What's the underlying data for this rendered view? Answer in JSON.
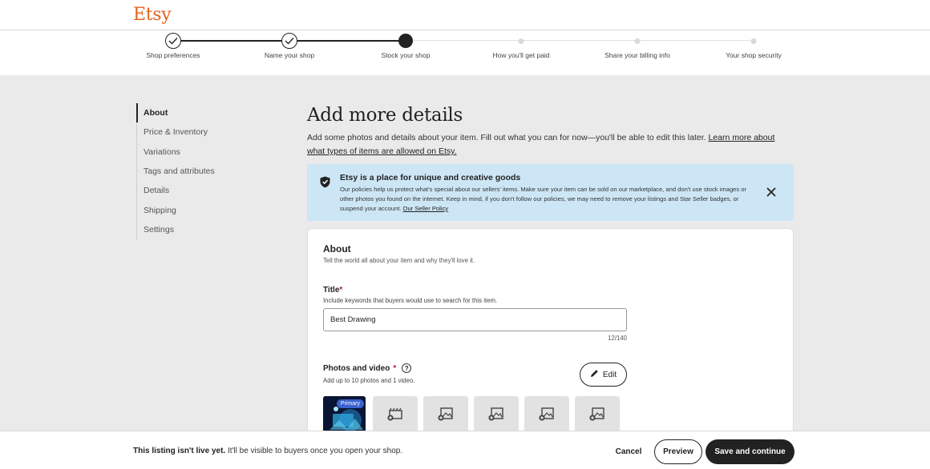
{
  "brand": {
    "logo": "Etsy",
    "color": "#e4631d"
  },
  "steps": [
    {
      "label": "Shop preferences",
      "status": "done"
    },
    {
      "label": "Name your shop",
      "status": "done"
    },
    {
      "label": "Stock your shop",
      "status": "current"
    },
    {
      "label": "How you'll get paid",
      "status": "future"
    },
    {
      "label": "Share your billing info",
      "status": "future"
    },
    {
      "label": "Your shop security",
      "status": "future"
    }
  ],
  "sidebar": {
    "items": [
      {
        "label": "About",
        "active": true
      },
      {
        "label": "Price & Inventory"
      },
      {
        "label": "Variations"
      },
      {
        "label": "Tags and attributes"
      },
      {
        "label": "Details"
      },
      {
        "label": "Shipping"
      },
      {
        "label": "Settings"
      }
    ]
  },
  "main": {
    "title": "Add more details",
    "description": "Add some photos and details about your item. Fill out what you can for now—you'll be able to edit this later.",
    "description_link": "Learn more about what types of items are allowed on Etsy."
  },
  "banner": {
    "title": "Etsy is a place for unique and creative goods",
    "text": "Our policies help us protect what's special about our sellers' items. Make sure your item can be sold on our marketplace, and don't use stock images or other photos you found on the internet. Keep in mind, if you don't follow our policies, we may need to remove your listings and Star Seller badges, or suspend your account.",
    "link": "Our Seller Policy",
    "color": "#cde6f6"
  },
  "about": {
    "heading": "About",
    "subheading": "Tell the world all about your item and why they'll love it.",
    "title_field": {
      "label": "Title",
      "required_mark": "*",
      "help": "Include keywords that buyers would use to search for this item.",
      "value": "Best Drawing",
      "char_count": "12/140"
    },
    "photos": {
      "label": "Photos and video",
      "required_mark": "*",
      "help_icon": "?",
      "help": "Add up to 10 photos and 1 video.",
      "edit_label": "Edit",
      "primary_badge": "Primary"
    }
  },
  "footer": {
    "status_bold": "This listing isn't live yet.",
    "status_rest": " It'll be visible to buyers once you open your shop.",
    "cancel_label": "Cancel",
    "preview_label": "Preview",
    "save_label": "Save and continue"
  }
}
